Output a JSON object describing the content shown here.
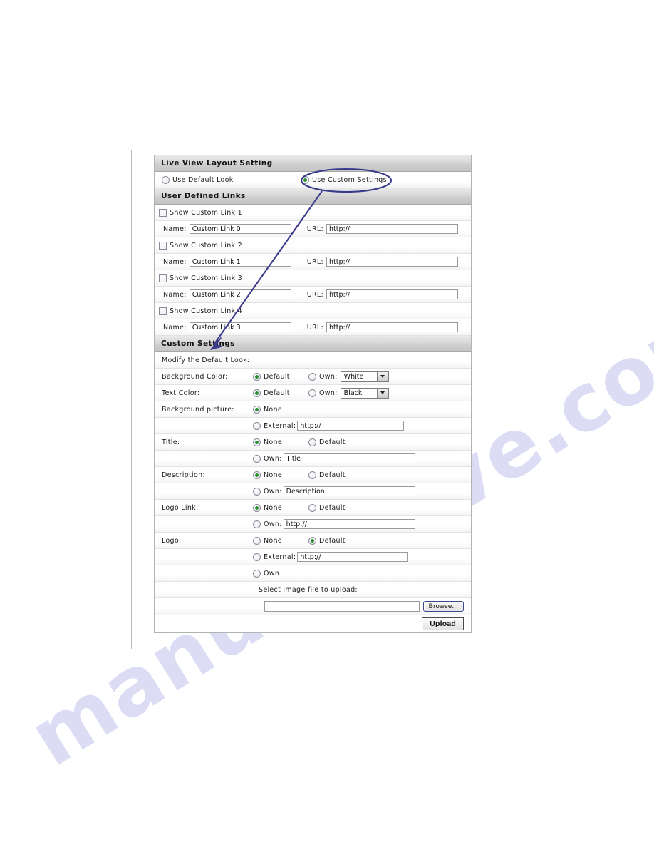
{
  "watermark": {
    "text": "manualshive.com"
  },
  "panel": {
    "sections": {
      "live_view": "Live View Layout Setting",
      "user_links": "User Defined Links",
      "custom_settings": "Custom Settings"
    },
    "layout_choice": {
      "default_label": "Use Default Look",
      "default_selected": false,
      "custom_label": "Use Custom Settings",
      "custom_selected": true
    },
    "links": [
      {
        "show_label": "Show Custom Link  1",
        "checked": false,
        "name_label": "Name:",
        "name_value": "Custom Link 0",
        "url_label": "URL:",
        "url_value": "http://"
      },
      {
        "show_label": "Show Custom Link  2",
        "checked": false,
        "name_label": "Name:",
        "name_value": "Custom Link 1",
        "url_label": "URL:",
        "url_value": "http://"
      },
      {
        "show_label": "Show Custom Link  3",
        "checked": false,
        "name_label": "Name:",
        "name_value": "Custom Link 2",
        "url_label": "URL:",
        "url_value": "http://"
      },
      {
        "show_label": "Show Custom Link  4",
        "checked": false,
        "name_label": "Name:",
        "name_value": "Custom Link 3",
        "url_label": "URL:",
        "url_value": "http://"
      }
    ],
    "custom": {
      "modify_note": "Modify the Default Look:",
      "background_color": {
        "label": "Background Color:",
        "default_label": "Default",
        "default_selected": true,
        "own_label": "Own:",
        "own_selected": false,
        "select_value": "White"
      },
      "text_color": {
        "label": "Text Color:",
        "default_label": "Default",
        "default_selected": true,
        "own_label": "Own:",
        "own_selected": false,
        "select_value": "Black"
      },
      "background_picture": {
        "label": "Background picture:",
        "none_label": "None",
        "none_selected": true,
        "external_label": "External:",
        "external_selected": false,
        "external_value": "http://"
      },
      "title": {
        "label": "Title:",
        "none_label": "None",
        "none_selected": true,
        "default_label": "Default",
        "default_selected": false,
        "own_label": "Own:",
        "own_selected": false,
        "own_value": "Title"
      },
      "description": {
        "label": "Description:",
        "none_label": "None",
        "none_selected": true,
        "default_label": "Default",
        "default_selected": false,
        "own_label": "Own:",
        "own_selected": false,
        "own_value": "Description"
      },
      "logo_link": {
        "label": "Logo Link:",
        "none_label": "None",
        "none_selected": true,
        "default_label": "Default",
        "default_selected": false,
        "own_label": "Own:",
        "own_selected": false,
        "own_value": "http://"
      },
      "logo": {
        "label": "Logo:",
        "none_label": "None",
        "none_selected": false,
        "default_label": "Default",
        "default_selected": true,
        "external_label": "External:",
        "external_selected": false,
        "external_value": "http://",
        "own_label": "Own",
        "own_selected": false
      },
      "upload": {
        "prompt": "Select image file to upload:",
        "file_value": "",
        "browse_label": "Browse...",
        "upload_label": "Upload"
      }
    }
  },
  "annotation": {
    "ellipse_color": "#3b3b8c",
    "arrow_color": "#3b3b8c",
    "target_label": "Use Custom Settings"
  }
}
